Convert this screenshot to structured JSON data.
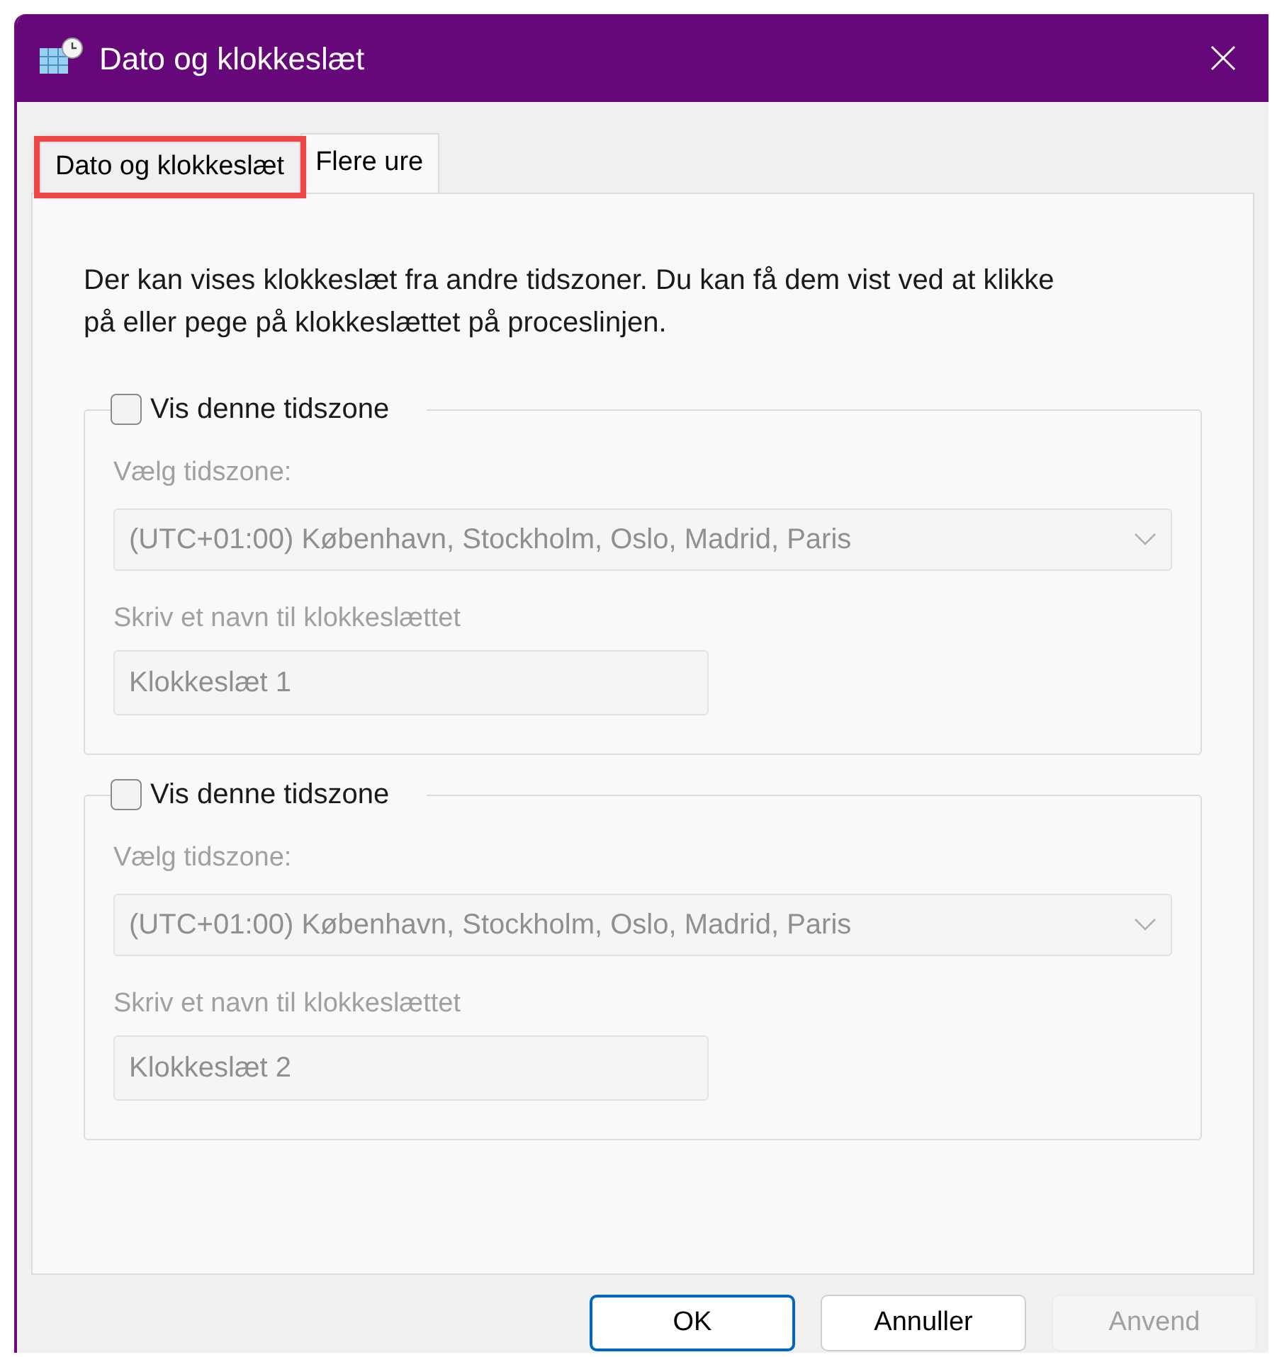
{
  "window": {
    "title": "Dato og klokkeslæt"
  },
  "tabs": [
    {
      "label": "Dato og klokkeslæt",
      "selected": false,
      "highlighted": true
    },
    {
      "label": "Flere ure",
      "selected": true,
      "highlighted": false
    }
  ],
  "description": "Der kan vises klokkeslæt fra andre tidszoner. Du kan få dem vist ved at klikke på eller pege på klokkeslættet på proceslinjen.",
  "clocks": [
    {
      "checkbox_label": "Vis denne tidszone",
      "checked": false,
      "disabled": true,
      "timezone_label": "Vælg tidszone:",
      "timezone": "(UTC+01:00) København, Stockholm, Oslo, Madrid, Paris",
      "name_label": "Skriv et navn til klokkeslættet",
      "name_value": "Klokkeslæt 1"
    },
    {
      "checkbox_label": "Vis denne tidszone",
      "checked": false,
      "disabled": true,
      "timezone_label": "Vælg tidszone:",
      "timezone": "(UTC+01:00) København, Stockholm, Oslo, Madrid, Paris",
      "name_label": "Skriv et navn til klokkeslættet",
      "name_value": "Klokkeslæt 2"
    }
  ],
  "buttons": [
    {
      "label": "OK",
      "kind": "default",
      "disabled": false
    },
    {
      "label": "Annuller",
      "kind": "normal",
      "disabled": false
    },
    {
      "label": "Anvend",
      "kind": "normal",
      "disabled": true
    }
  ]
}
